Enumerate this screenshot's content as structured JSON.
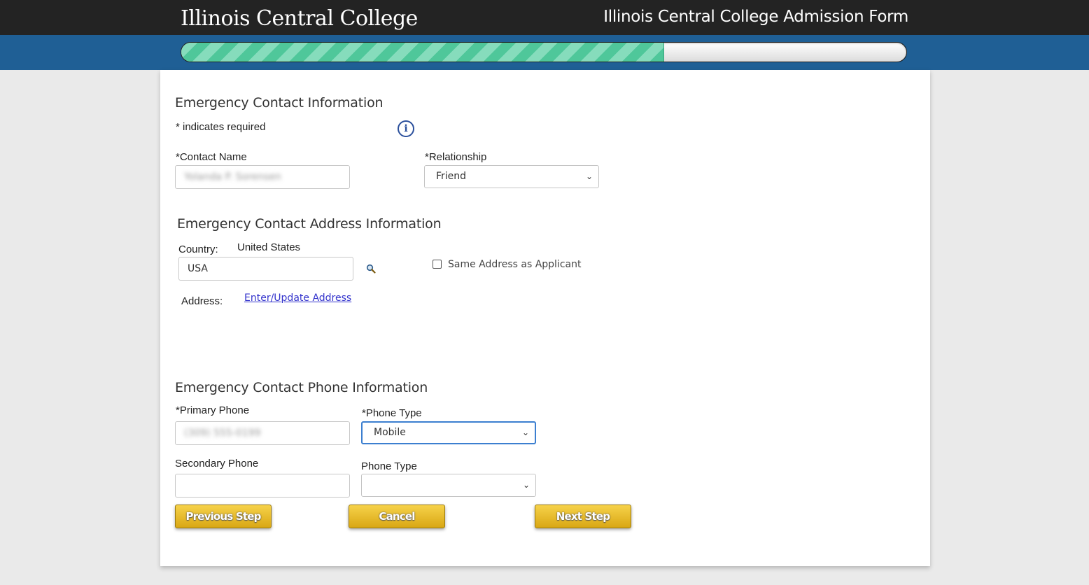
{
  "header": {
    "logo_text": "Illinois Central College",
    "form_title": "Illinois Central College Admission Form"
  },
  "progress": {
    "fraction": 0.665
  },
  "emergency_contact": {
    "heading": "Emergency Contact Information",
    "required_note": "* indicates required",
    "info_icon": "info-icon",
    "contact_name_label": "*Contact Name",
    "contact_name_value": "Yolanda P. Sorensen",
    "relationship_label": "*Relationship",
    "relationship_value": "Friend"
  },
  "address": {
    "heading": "Emergency Contact Address Information",
    "country_label": "Country:",
    "country_name": "United States",
    "country_code": "USA",
    "search_icon": "search-icon",
    "same_address_label": "Same Address as Applicant",
    "address_label": "Address:",
    "update_link": "Enter/Update Address"
  },
  "phone": {
    "heading": "Emergency Contact Phone Information",
    "primary_label": "*Primary Phone",
    "primary_value": "(309) 555-0199",
    "primary_type_label": "*Phone Type",
    "primary_type_value": "Mobile",
    "secondary_label": "Secondary Phone",
    "secondary_value": "",
    "secondary_type_label": "Phone Type",
    "secondary_type_value": ""
  },
  "buttons": {
    "previous": "Previous Step",
    "cancel": "Cancel",
    "next": "Next Step"
  },
  "colors": {
    "topbar": "#232323",
    "bluebar": "#1f5f95",
    "progress_fill": "#4fc79a",
    "button": "#e3b523"
  }
}
